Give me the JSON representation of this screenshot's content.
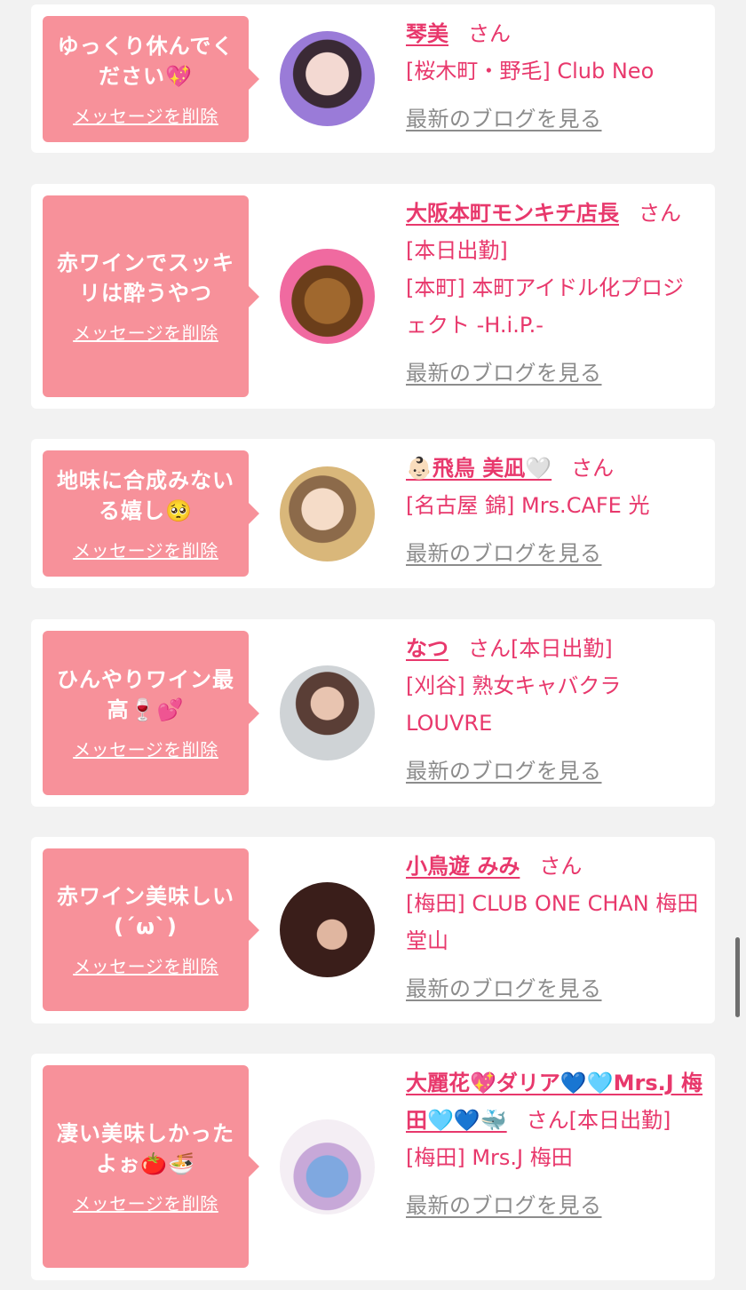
{
  "delete_label": "メッセージを削除",
  "blog_label": "最新のブログを見る",
  "san": "さん",
  "cards": [
    {
      "message": "ゆっくり休んでください💖",
      "name": "琴美",
      "status": "",
      "shop": "[桜木町・野毛] Club Neo"
    },
    {
      "message": "赤ワインでスッキリは酔うやつ",
      "name": "大阪本町モンキチ店長",
      "status": "[本日出勤]",
      "shop": "[本町] 本町アイドル化プロジェクト -H.i.P.-"
    },
    {
      "message": "地味に合成みないる嬉し🥺",
      "name": "👶🏻飛鳥 美凪🤍",
      "status": "",
      "shop": "[名古屋 錦] Mrs.CAFE 光"
    },
    {
      "message": "ひんやりワイン最高🍷💕",
      "name": "なつ",
      "status": "[本日出勤]",
      "shop": "[刈谷] 熟女キャバクラ LOUVRE"
    },
    {
      "message": "赤ワイン美味しい(´ω`)",
      "name": "小鳥遊 みみ",
      "status": "",
      "shop": "[梅田] CLUB ONE CHAN 梅田堂山"
    },
    {
      "message": "凄い美味しかったよぉ🍅🍜",
      "name": "大麗花💖ダリア💙🩵Mrs.J 梅田🩵💙🐳",
      "status": "[本日出勤]",
      "shop": "[梅田] Mrs.J 梅田"
    }
  ]
}
